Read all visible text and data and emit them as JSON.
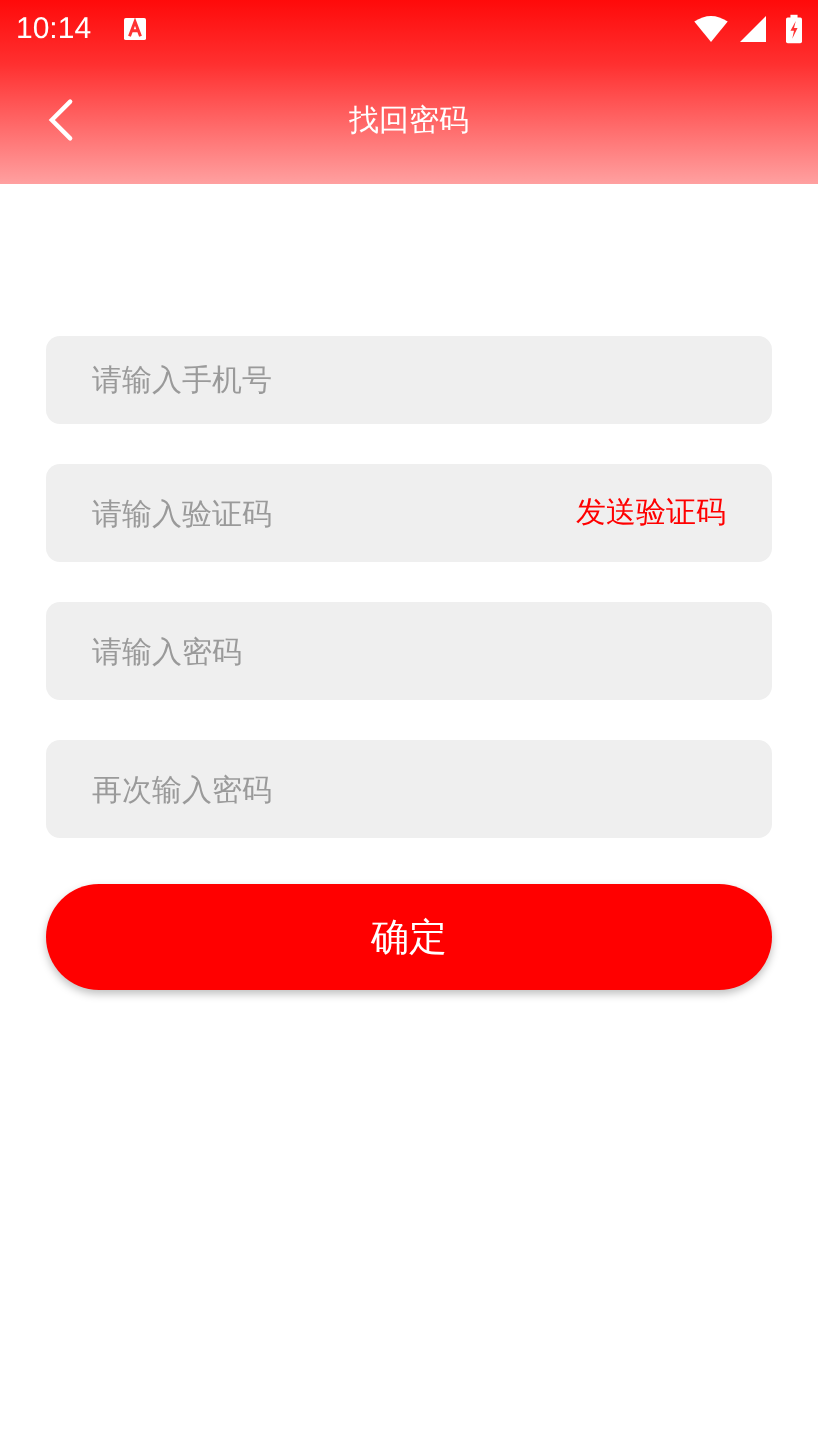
{
  "status_bar": {
    "time": "10:14"
  },
  "toolbar": {
    "title": "找回密码"
  },
  "fields": [
    {
      "placeholder": "请输入手机号"
    },
    {
      "placeholder": "请输入验证码",
      "action": "发送验证码"
    },
    {
      "placeholder": "请输入密码"
    },
    {
      "placeholder": "再次输入密码"
    }
  ],
  "submit": "确定"
}
